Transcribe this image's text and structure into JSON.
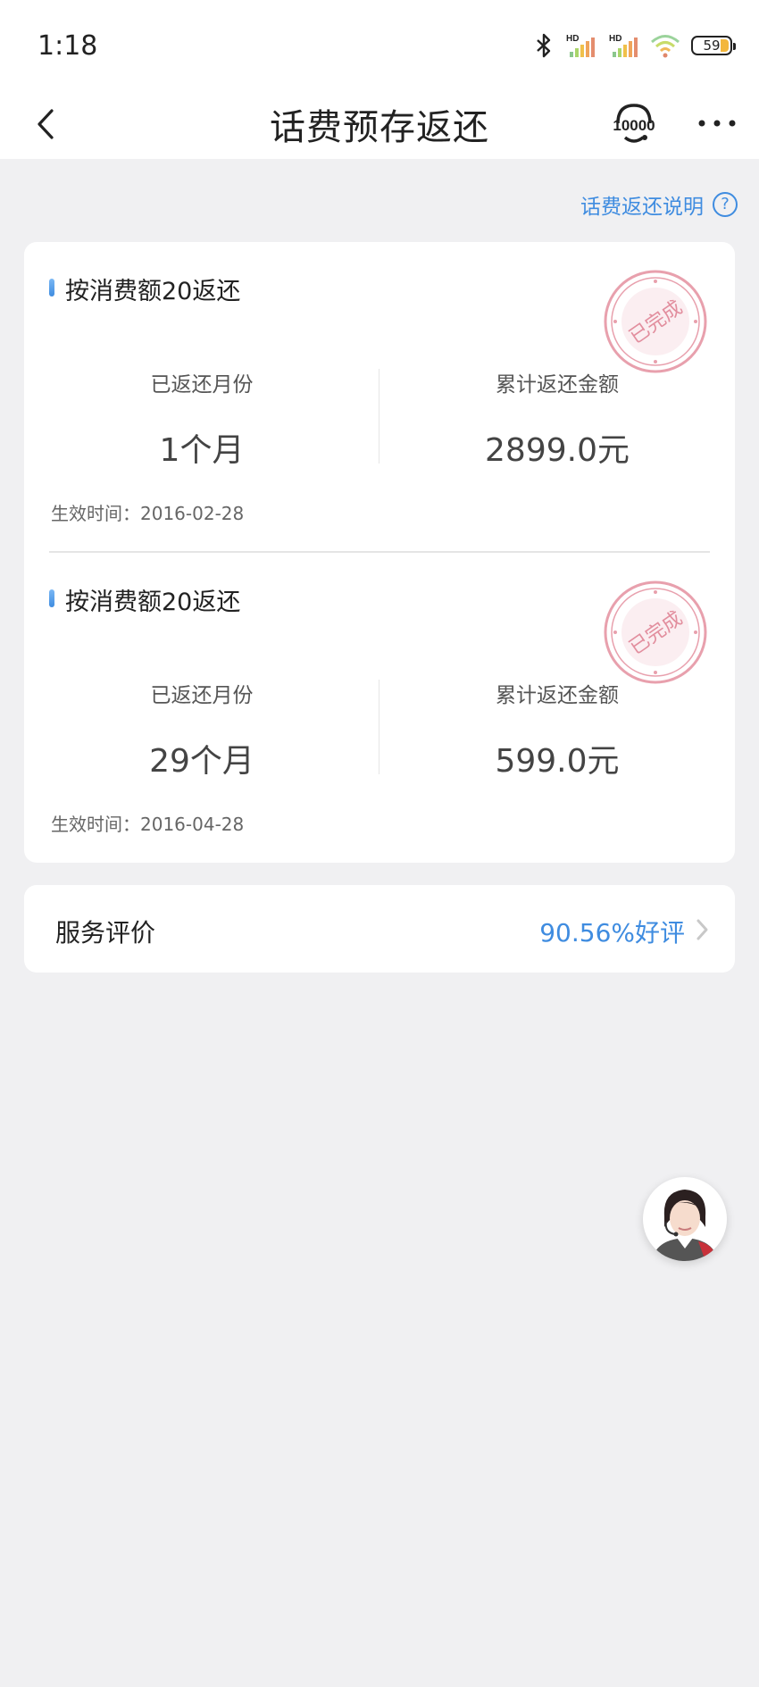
{
  "status_bar": {
    "time": "1:18",
    "network_1": "HD",
    "network_2": "HD",
    "battery": "59"
  },
  "nav": {
    "title": "话费预存返还",
    "service_badge": "10000"
  },
  "help_link": {
    "label": "话费返还说明",
    "icon_text": "?"
  },
  "stamp_text": "已完成",
  "records": [
    {
      "title": "按消费额20返还",
      "months_label": "已返还月份",
      "months_value": "1个月",
      "amount_label": "累计返还金额",
      "amount_value": "2899.0元",
      "effective": "生效时间：2016-02-28"
    },
    {
      "title": "按消费额20返还",
      "months_label": "已返还月份",
      "months_value": "29个月",
      "amount_label": "累计返还金额",
      "amount_value": "599.0元",
      "effective": "生效时间：2016-04-28"
    }
  ],
  "rating": {
    "label": "服务评价",
    "value": "90.56%好评"
  },
  "colors": {
    "accent": "#3f8ce0",
    "stamp": "#e8a0ad",
    "background": "#f0f0f2"
  }
}
